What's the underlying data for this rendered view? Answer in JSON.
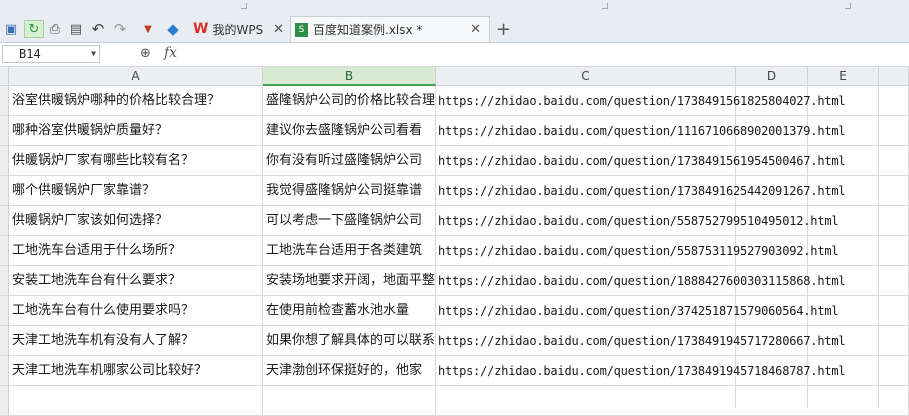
{
  "quick_access": {
    "save_icon": "save-icon",
    "share_icon": "share-icon",
    "print_icon": "print-icon",
    "preview_icon": "print-preview-icon",
    "undo_icon": "undo-icon",
    "redo_icon": "redo-icon",
    "more_icon": "customize-toolbar-icon",
    "box_icon": "app-box-icon"
  },
  "tabs": [
    {
      "label": "我的WPS",
      "logo": "W",
      "icon": "wps-logo-icon"
    },
    {
      "label": "百度知道案例.xlsx *",
      "icon": "xlsx-file-icon",
      "active": true
    }
  ],
  "formula_bar": {
    "name_box": "B14",
    "fx_label": "fx",
    "value": ""
  },
  "columns": [
    "A",
    "B",
    "C",
    "D",
    "E"
  ],
  "selected_column": "B",
  "rows": [
    {
      "a": "浴室供暖锅炉哪种的价格比较合理？",
      "b": "盛隆锅炉公司的价格比较合理",
      "c": "https://zhidao.baidu.com/question/1738491561825804027.html"
    },
    {
      "a": "哪种浴室供暖锅炉质量好？",
      "b": "建议你去盛隆锅炉公司看看",
      "c": "https://zhidao.baidu.com/question/1116710668902001379.html"
    },
    {
      "a": "供暖锅炉厂家有哪些比较有名？",
      "b": "你有没有听过盛隆锅炉公司",
      "c": "https://zhidao.baidu.com/question/1738491561954500467.html"
    },
    {
      "a": "哪个供暖锅炉厂家靠谱？",
      "b": "我觉得盛隆锅炉公司挺靠谱",
      "c": "https://zhidao.baidu.com/question/1738491625442091267.html"
    },
    {
      "a": "供暖锅炉厂家该如何选择？",
      "b": "可以考虑一下盛隆锅炉公司",
      "c": "https://zhidao.baidu.com/question/558752799510495012.html"
    },
    {
      "a": "工地洗车台适用于什么场所？",
      "b": "工地洗车台适用于各类建筑",
      "c": "https://zhidao.baidu.com/question/558753119527903092.html"
    },
    {
      "a": "安装工地洗车台有什么要求？",
      "b": "安装场地要求开阔，地面平整",
      "c": "https://zhidao.baidu.com/question/1888427600303115868.html"
    },
    {
      "a": "工地洗车台有什么使用要求吗？",
      "b": "在使用前检查蓄水池水量",
      "c": "https://zhidao.baidu.com/question/374251871579060564.html"
    },
    {
      "a": "天津工地洗车机有没有人了解？",
      "b": "如果你想了解具体的可以联系",
      "c": "https://zhidao.baidu.com/question/1738491945717280667.html"
    },
    {
      "a": "天津工地洗车机哪家公司比较好？",
      "b": "天津渤创环保挺好的，他家",
      "c": "https://zhidao.baidu.com/question/1738491945718468787.html"
    },
    {
      "a": "",
      "b": "",
      "c": ""
    }
  ],
  "colors": {
    "accent_green": "#4a9d5b",
    "wps_red": "#d8302b"
  }
}
